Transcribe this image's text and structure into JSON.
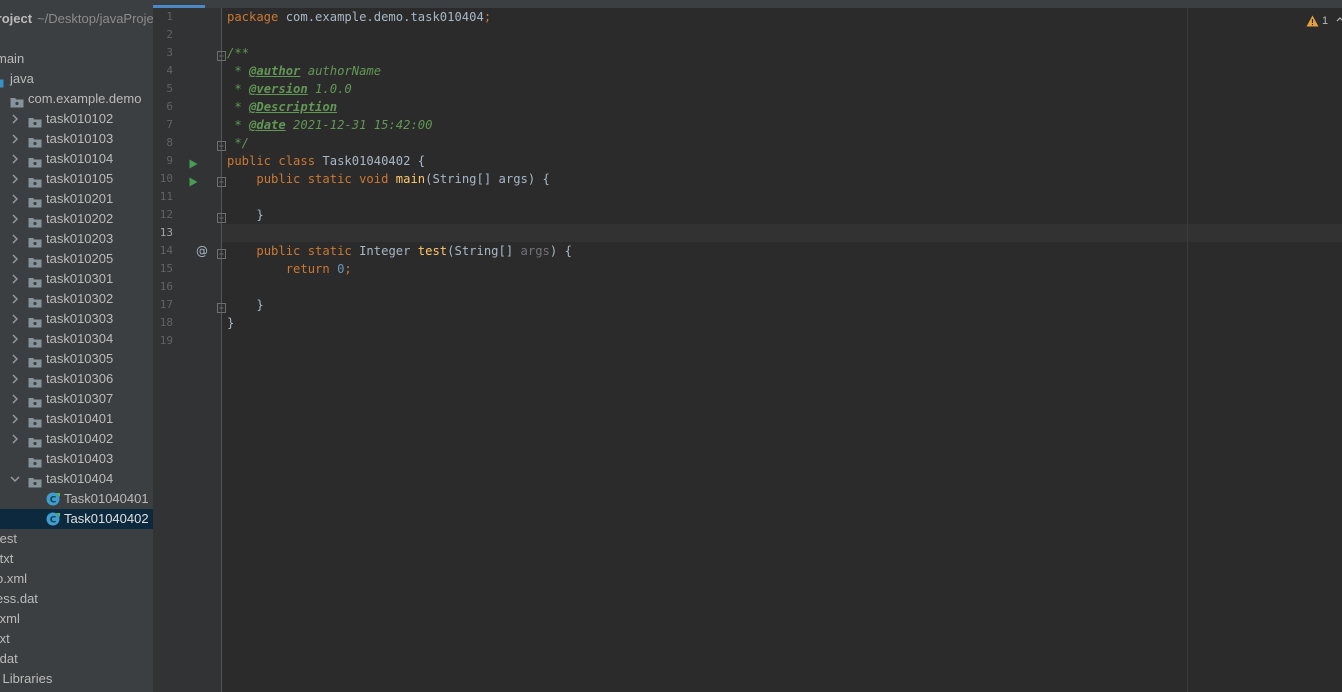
{
  "project_panel": {
    "title": "Project",
    "path": "~/Desktop/javaProject",
    "tree": [
      {
        "label": "main",
        "type": "folder-plain",
        "indent": 0,
        "chevron": "none"
      },
      {
        "label": "java",
        "type": "source-root",
        "indent": 0,
        "chevron": "none"
      },
      {
        "label": "com.example.demo",
        "type": "package",
        "indent": 1,
        "chevron": "none"
      },
      {
        "label": "task010102",
        "type": "package",
        "indent": 2,
        "chevron": "right"
      },
      {
        "label": "task010103",
        "type": "package",
        "indent": 2,
        "chevron": "right"
      },
      {
        "label": "task010104",
        "type": "package",
        "indent": 2,
        "chevron": "right"
      },
      {
        "label": "task010105",
        "type": "package",
        "indent": 2,
        "chevron": "right"
      },
      {
        "label": "task010201",
        "type": "package",
        "indent": 2,
        "chevron": "right"
      },
      {
        "label": "task010202",
        "type": "package",
        "indent": 2,
        "chevron": "right"
      },
      {
        "label": "task010203",
        "type": "package",
        "indent": 2,
        "chevron": "right"
      },
      {
        "label": "task010205",
        "type": "package",
        "indent": 2,
        "chevron": "right"
      },
      {
        "label": "task010301",
        "type": "package",
        "indent": 2,
        "chevron": "right"
      },
      {
        "label": "task010302",
        "type": "package",
        "indent": 2,
        "chevron": "right"
      },
      {
        "label": "task010303",
        "type": "package",
        "indent": 2,
        "chevron": "right"
      },
      {
        "label": "task010304",
        "type": "package",
        "indent": 2,
        "chevron": "right"
      },
      {
        "label": "task010305",
        "type": "package",
        "indent": 2,
        "chevron": "right"
      },
      {
        "label": "task010306",
        "type": "package",
        "indent": 2,
        "chevron": "right"
      },
      {
        "label": "task010307",
        "type": "package",
        "indent": 2,
        "chevron": "right"
      },
      {
        "label": "task010401",
        "type": "package",
        "indent": 2,
        "chevron": "right"
      },
      {
        "label": "task010402",
        "type": "package",
        "indent": 2,
        "chevron": "right"
      },
      {
        "label": "task010403",
        "type": "package",
        "indent": 2,
        "chevron": "none"
      },
      {
        "label": "task010404",
        "type": "package",
        "indent": 2,
        "chevron": "down"
      },
      {
        "label": "Task01040401",
        "type": "class",
        "indent": 3,
        "chevron": "none"
      },
      {
        "label": "Task01040402",
        "type": "class",
        "indent": 3,
        "chevron": "none",
        "selected": true
      },
      {
        "label": "test",
        "type": "file",
        "indent": 0,
        "chevron": "none"
      },
      {
        "label": ".txt",
        "type": "file",
        "indent": 0,
        "chevron": "none"
      },
      {
        "label": "o.xml",
        "type": "file",
        "indent": 0,
        "chevron": "none"
      },
      {
        "label": "ess.dat",
        "type": "file",
        "indent": 0,
        "chevron": "none"
      },
      {
        "label": ".xml",
        "type": "file",
        "indent": 0,
        "chevron": "none"
      },
      {
        "label": "txt",
        "type": "file",
        "indent": 0,
        "chevron": "none"
      },
      {
        "label": ".dat",
        "type": "file",
        "indent": 0,
        "chevron": "none"
      },
      {
        "label": "l Libraries",
        "type": "file",
        "indent": 0,
        "chevron": "none"
      }
    ]
  },
  "editor": {
    "line_numbers": [
      "1",
      "2",
      "3",
      "4",
      "5",
      "6",
      "7",
      "8",
      "9",
      "10",
      "11",
      "12",
      "13",
      "14",
      "15",
      "16",
      "17",
      "18",
      "19"
    ],
    "current_line": 13,
    "lines": [
      [
        {
          "t": "package ",
          "c": "kw"
        },
        {
          "t": "com.example.demo.task010404",
          "c": "pl"
        },
        {
          "t": ";",
          "c": "kw"
        }
      ],
      [],
      [
        {
          "t": "/**",
          "c": "doc"
        }
      ],
      [
        {
          "t": " * ",
          "c": "doc"
        },
        {
          "t": "@author",
          "c": "tag"
        },
        {
          "t": " authorName",
          "c": "doc"
        }
      ],
      [
        {
          "t": " * ",
          "c": "doc"
        },
        {
          "t": "@version",
          "c": "tag"
        },
        {
          "t": " 1.0.0",
          "c": "doc"
        }
      ],
      [
        {
          "t": " * ",
          "c": "doc"
        },
        {
          "t": "@Description",
          "c": "tag"
        }
      ],
      [
        {
          "t": " * ",
          "c": "doc"
        },
        {
          "t": "@date",
          "c": "tag"
        },
        {
          "t": " 2021-12-31 15:42:00",
          "c": "doc"
        }
      ],
      [
        {
          "t": " */",
          "c": "doc"
        }
      ],
      [
        {
          "t": "public class ",
          "c": "kw"
        },
        {
          "t": "Task01040402 {",
          "c": "pl"
        }
      ],
      [
        {
          "t": "    ",
          "c": "pl"
        },
        {
          "t": "public static void ",
          "c": "kw"
        },
        {
          "t": "main",
          "c": "fn"
        },
        {
          "t": "(String[] args) {",
          "c": "pl"
        }
      ],
      [],
      [
        {
          "t": "    }",
          "c": "pl"
        }
      ],
      [],
      [
        {
          "t": "    ",
          "c": "pl"
        },
        {
          "t": "public static ",
          "c": "kw"
        },
        {
          "t": "Integer ",
          "c": "pl"
        },
        {
          "t": "test",
          "c": "fn"
        },
        {
          "t": "(String[] ",
          "c": "pl"
        },
        {
          "t": "args",
          "c": "unused"
        },
        {
          "t": ") {",
          "c": "pl"
        }
      ],
      [
        {
          "t": "        ",
          "c": "pl"
        },
        {
          "t": "return ",
          "c": "kw"
        },
        {
          "t": "0",
          "c": "num"
        },
        {
          "t": ";",
          "c": "kw"
        }
      ],
      [],
      [
        {
          "t": "    }",
          "c": "pl"
        }
      ],
      [
        {
          "t": "}",
          "c": "pl"
        }
      ],
      []
    ],
    "gutter_icons": [
      {
        "line": 3,
        "icon": "fold-icon"
      },
      {
        "line": 8,
        "icon": "fold-icon"
      },
      {
        "line": 9,
        "icon": "run-icon"
      },
      {
        "line": 10,
        "icon": "run-icon"
      },
      {
        "line": 10,
        "icon": "fold-icon"
      },
      {
        "line": 12,
        "icon": "fold-icon"
      },
      {
        "line": 14,
        "icon": "annotation-at-icon",
        "text": "@"
      },
      {
        "line": 14,
        "icon": "fold-icon"
      },
      {
        "line": 17,
        "icon": "fold-icon"
      }
    ]
  },
  "inspection": {
    "icon": "warning-icon",
    "count": "1"
  },
  "colors": {
    "keyword": "#cc7832",
    "function": "#ffc66d",
    "doc_comment": "#629755",
    "number": "#6897bb",
    "plain": "#a9b7c6",
    "editor_bg": "#2b2b2b",
    "selection": "#0d293e",
    "warning": "#e6a23c",
    "run": "#499c54"
  }
}
